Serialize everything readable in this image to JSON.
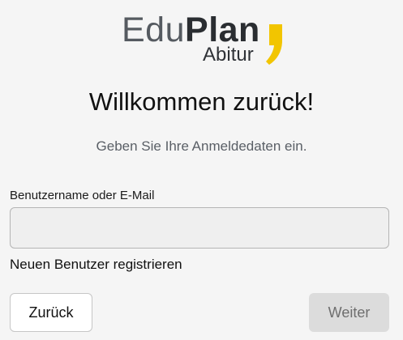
{
  "logo": {
    "brand_light": "Edu",
    "brand_bold": "Plan",
    "sub": "Abitur",
    "accent_color": "#f2c500"
  },
  "title": "Willkommen zurück!",
  "subtitle": "Geben Sie Ihre Anmeldedaten ein.",
  "login": {
    "username_label": "Benutzername oder E-Mail",
    "username_value": "",
    "register_link": "Neuen Benutzer registrieren"
  },
  "buttons": {
    "back": "Zurück",
    "next": "Weiter",
    "next_state": "disabled"
  }
}
